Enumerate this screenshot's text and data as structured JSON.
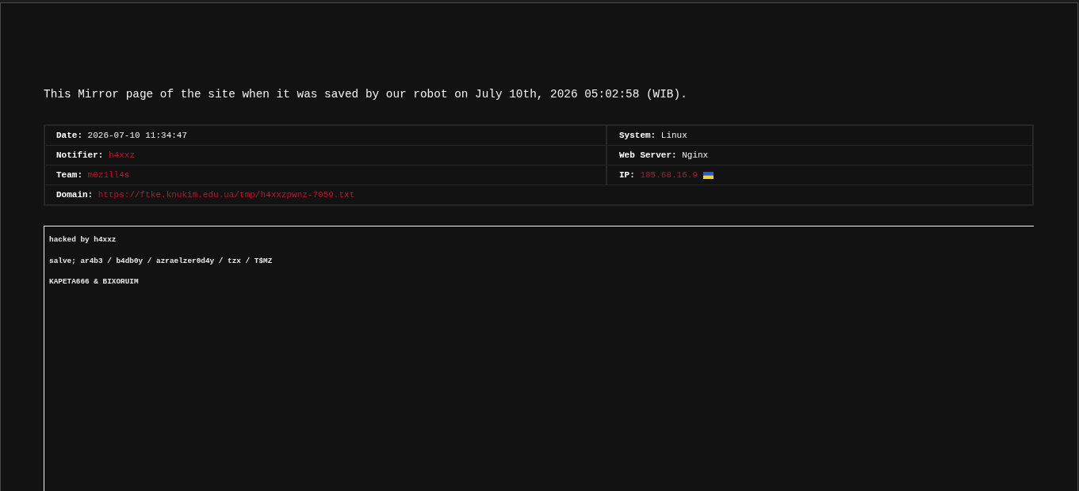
{
  "notice": "This Mirror page of the site when it was saved by our robot on July 10th, 2026 05:02:58 (WIB).",
  "details": {
    "rows": [
      {
        "cells": [
          {
            "label": "Date:",
            "value": "2026-07-10 11:34:47",
            "kind": "text"
          },
          {
            "label": "System:",
            "value": "Linux",
            "kind": "text"
          }
        ]
      },
      {
        "cells": [
          {
            "label": "Notifier:",
            "value": "h4xxz",
            "kind": "link"
          },
          {
            "label": "Web Server:",
            "value": "Nginx",
            "kind": "text"
          }
        ]
      },
      {
        "cells": [
          {
            "label": "Team:",
            "value": "m0z1ll4s",
            "kind": "link"
          },
          {
            "label": "IP:",
            "value": "185.68.16.9",
            "kind": "ip"
          }
        ]
      },
      {
        "cells": [
          {
            "label": "Domain:",
            "value": "https://ftke.knukim.edu.ua/tmp/h4xxzpwnz-7059.txt",
            "kind": "link"
          }
        ]
      }
    ]
  },
  "mirror_frame": {
    "lines": [
      "hacked by h4xxz",
      "salve; ar4b3 / b4db0y / azraelzer0d4y / tzx / T$MZ",
      "KAPETA666 & BIXORUIM"
    ]
  }
}
